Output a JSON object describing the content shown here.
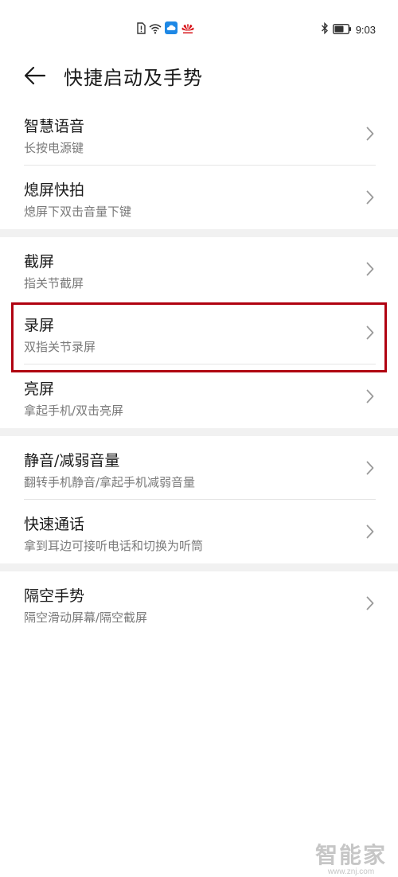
{
  "status_bar": {
    "time": "9:03",
    "icons": [
      "sim-alert-icon",
      "wifi-icon",
      "cloud-icon",
      "huawei-logo-icon",
      "bluetooth-icon",
      "battery-icon"
    ]
  },
  "header": {
    "title": "快捷启动及手势",
    "back_icon": "back-arrow-icon"
  },
  "groups": [
    {
      "items": [
        {
          "title": "智慧语音",
          "subtitle": "长按电源键"
        },
        {
          "title": "熄屏快拍",
          "subtitle": "熄屏下双击音量下键"
        }
      ]
    },
    {
      "items": [
        {
          "title": "截屏",
          "subtitle": "指关节截屏"
        },
        {
          "title": "录屏",
          "subtitle": "双指关节录屏",
          "highlighted": true
        },
        {
          "title": "亮屏",
          "subtitle": "拿起手机/双击亮屏"
        }
      ]
    },
    {
      "items": [
        {
          "title": "静音/减弱音量",
          "subtitle": "翻转手机静音/拿起手机减弱音量"
        },
        {
          "title": "快速通话",
          "subtitle": "拿到耳边可接听电话和切换为听筒"
        }
      ]
    },
    {
      "items": [
        {
          "title": "隔空手势",
          "subtitle": "隔空滑动屏幕/隔空截屏"
        }
      ]
    }
  ],
  "colors": {
    "highlight": "#b00010",
    "group_gap": "#f1f1f1",
    "subtitle": "#7a7a7a"
  },
  "watermark": {
    "name": "智能家",
    "url": "www.znj.com"
  }
}
